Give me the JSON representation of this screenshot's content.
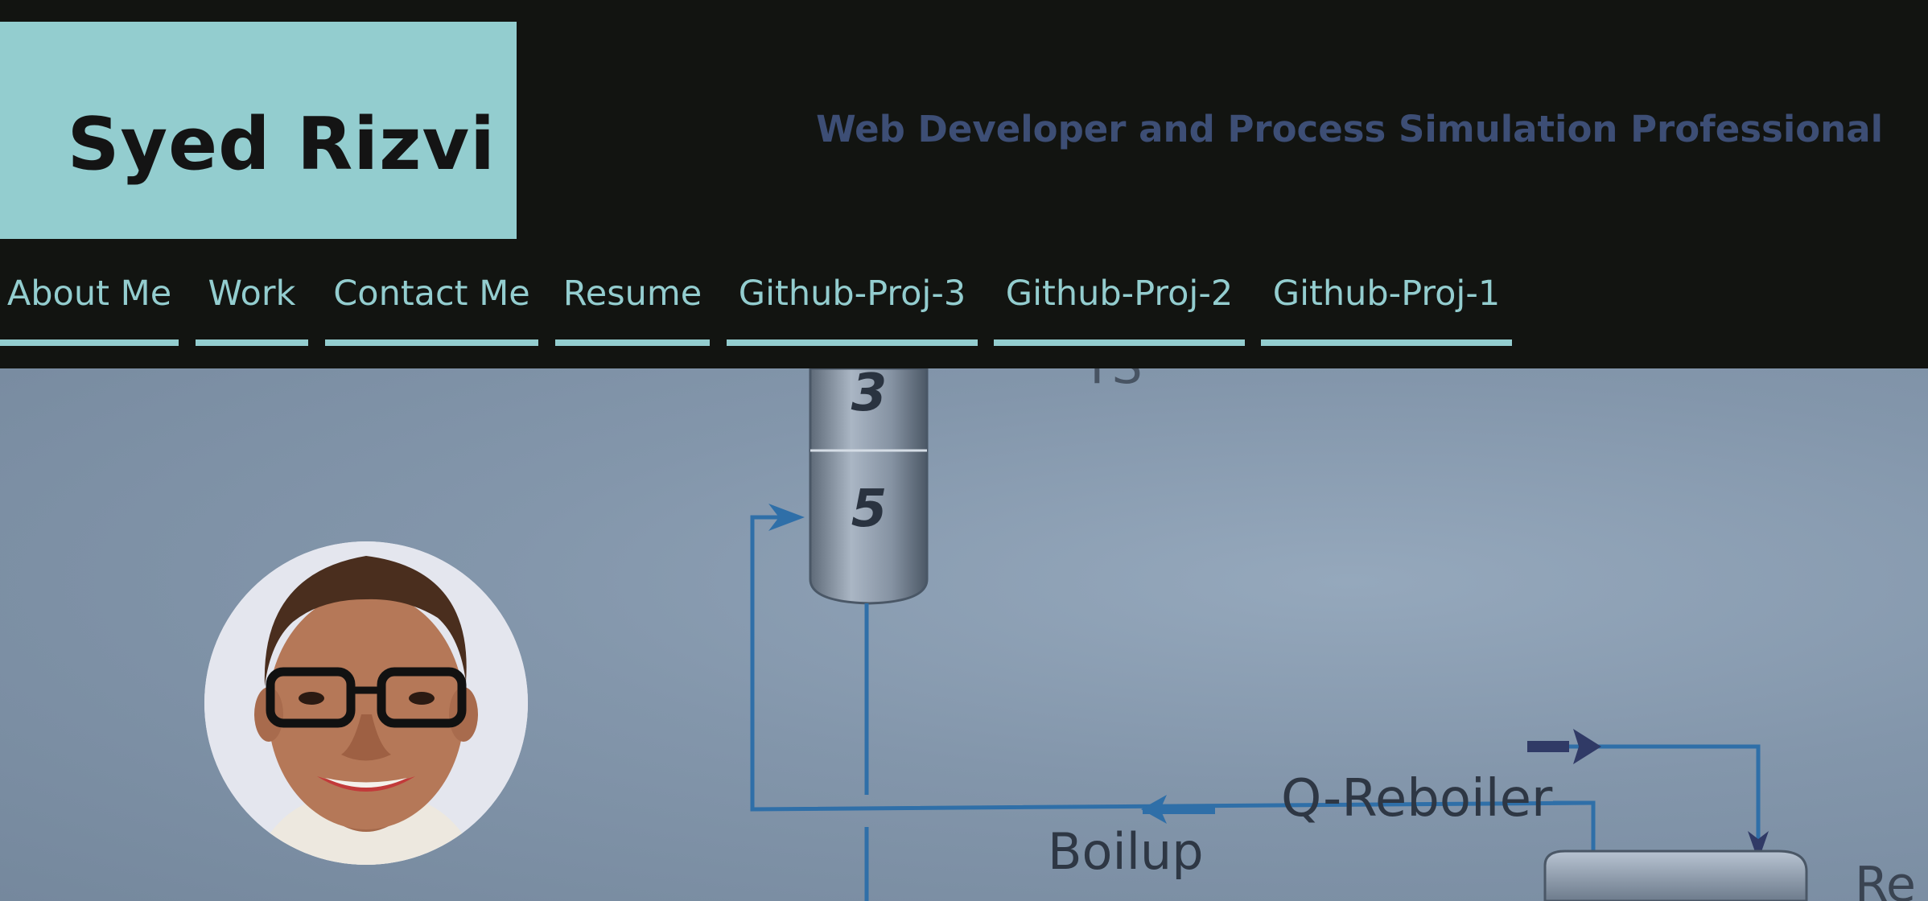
{
  "header": {
    "site_name": "Syed Rizvi",
    "tagline": "Web Developer and Process Simulation Professional"
  },
  "nav": {
    "items": [
      {
        "label": "About Me"
      },
      {
        "label": "Work"
      },
      {
        "label": "Contact Me"
      },
      {
        "label": "Resume"
      },
      {
        "label": "Github-Proj-3"
      },
      {
        "label": "Github-Proj-2"
      },
      {
        "label": "Github-Proj-1"
      }
    ]
  },
  "hero": {
    "diagram_labels": {
      "stage_3": "3",
      "stage_5": "5",
      "q_reboiler": "Q-Reboiler",
      "boilup": "Boilup"
    }
  },
  "colors": {
    "header_bg": "#121411",
    "accent": "#93cdcf",
    "tagline": "#3d4e75",
    "diagram_line": "#2f6fa8"
  },
  "icons": {
    "avatar": "profile-photo"
  }
}
